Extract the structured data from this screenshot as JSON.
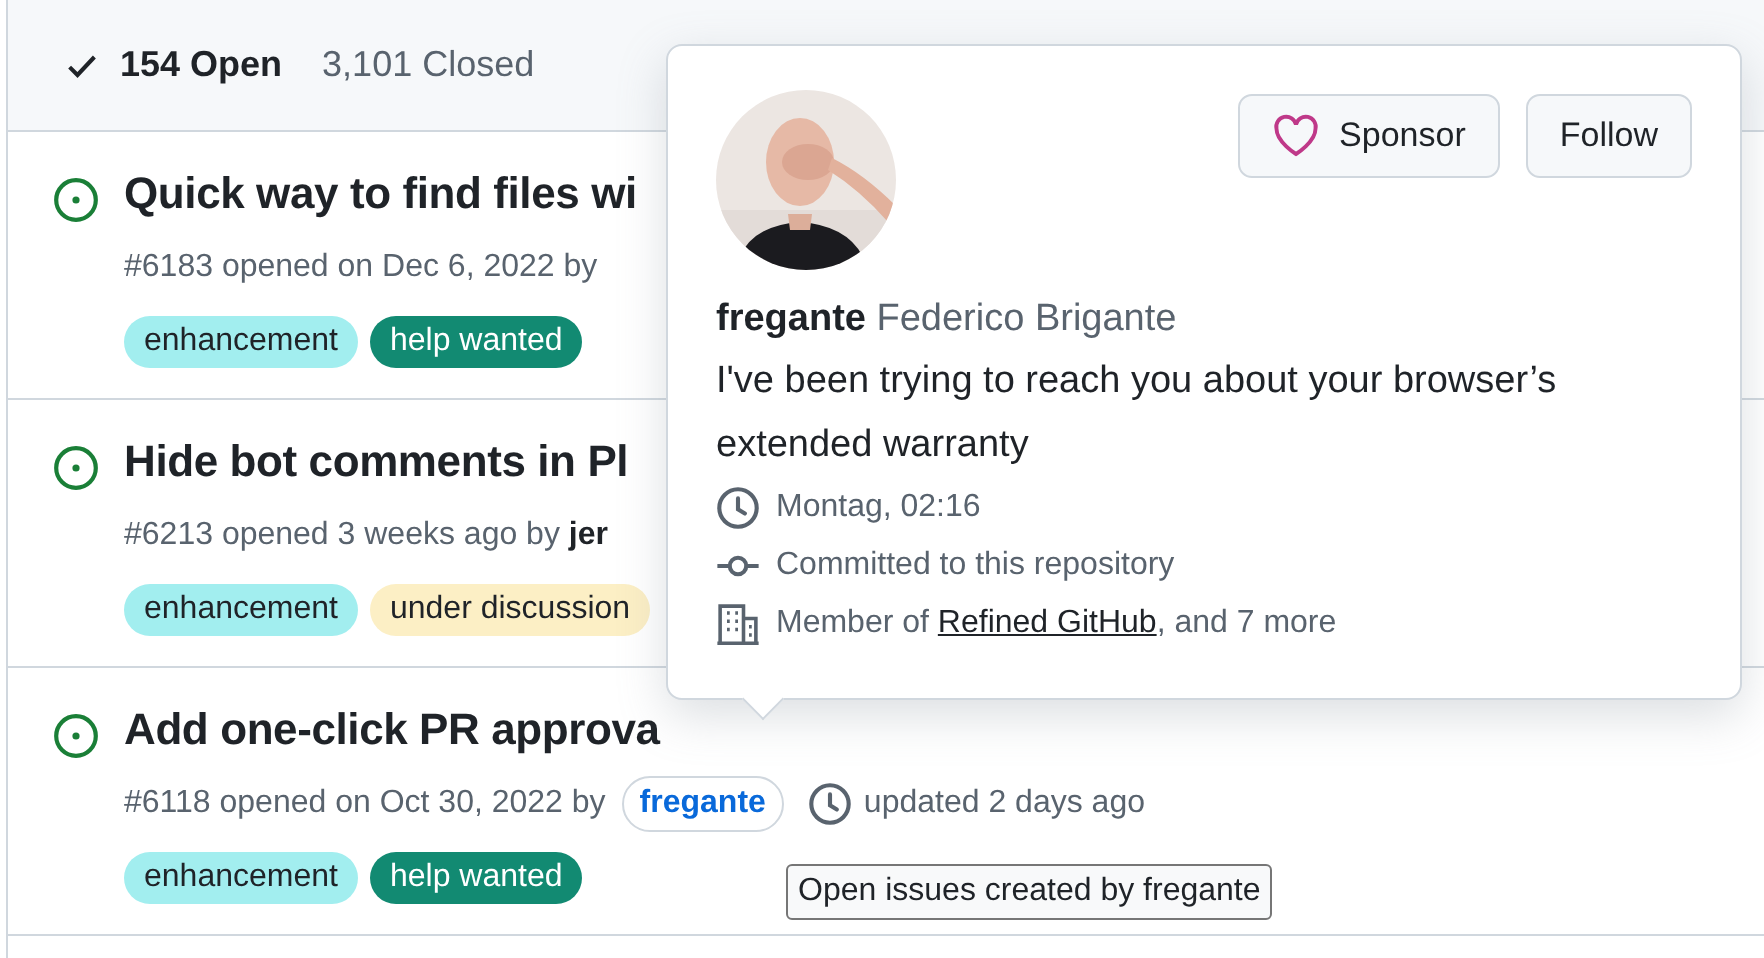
{
  "filter": {
    "tabs": [
      {
        "label": "154 Open",
        "selected": true
      },
      {
        "label": "3,101 Closed",
        "selected": false
      }
    ]
  },
  "issues": [
    {
      "title": "Quick way to find files wi",
      "meta": "#6183 opened on Dec 6, 2022 by",
      "labels": [
        {
          "name": "enhancement",
          "color": "#a2eeef"
        },
        {
          "name": "help wanted",
          "color": "#128a72"
        }
      ]
    },
    {
      "title": "Hide bot comments in Pl",
      "meta": "#6213 opened 3 weeks ago by **jer**",
      "labels": [
        {
          "name": "enhancement",
          "color": "#a2eeef"
        },
        {
          "name": "under discussion",
          "color": "#fcefc5"
        }
      ]
    },
    {
      "title": "Add one-click PR approva",
      "meta": "#6118 opened on Oct 30, 2022 by",
      "author": "fregante",
      "updated": "updated 2 days ago",
      "labels": [
        {
          "name": "enhancement",
          "color": "#a2eeef"
        },
        {
          "name": "help wanted",
          "color": "#128a72"
        }
      ]
    }
  ],
  "tooltip": {
    "text": "Open issues created by fregante"
  },
  "hovercard": {
    "buttons": [
      {
        "label": "Sponsor",
        "kind": "sponsor"
      },
      {
        "label": "Follow",
        "kind": "plain"
      }
    ],
    "username": "fregante",
    "full_name": "Federico Brigante",
    "bio": "I've been trying to reach you about your browser’s extended warranty",
    "details": [
      {
        "kind": "time",
        "text": "Montag, 02:16"
      },
      {
        "kind": "commit",
        "text": "Committed to this repository"
      },
      {
        "kind": "org",
        "text": "Member of ",
        "link": "Refined GitHub",
        "text_after": ", and 7 more"
      }
    ]
  }
}
